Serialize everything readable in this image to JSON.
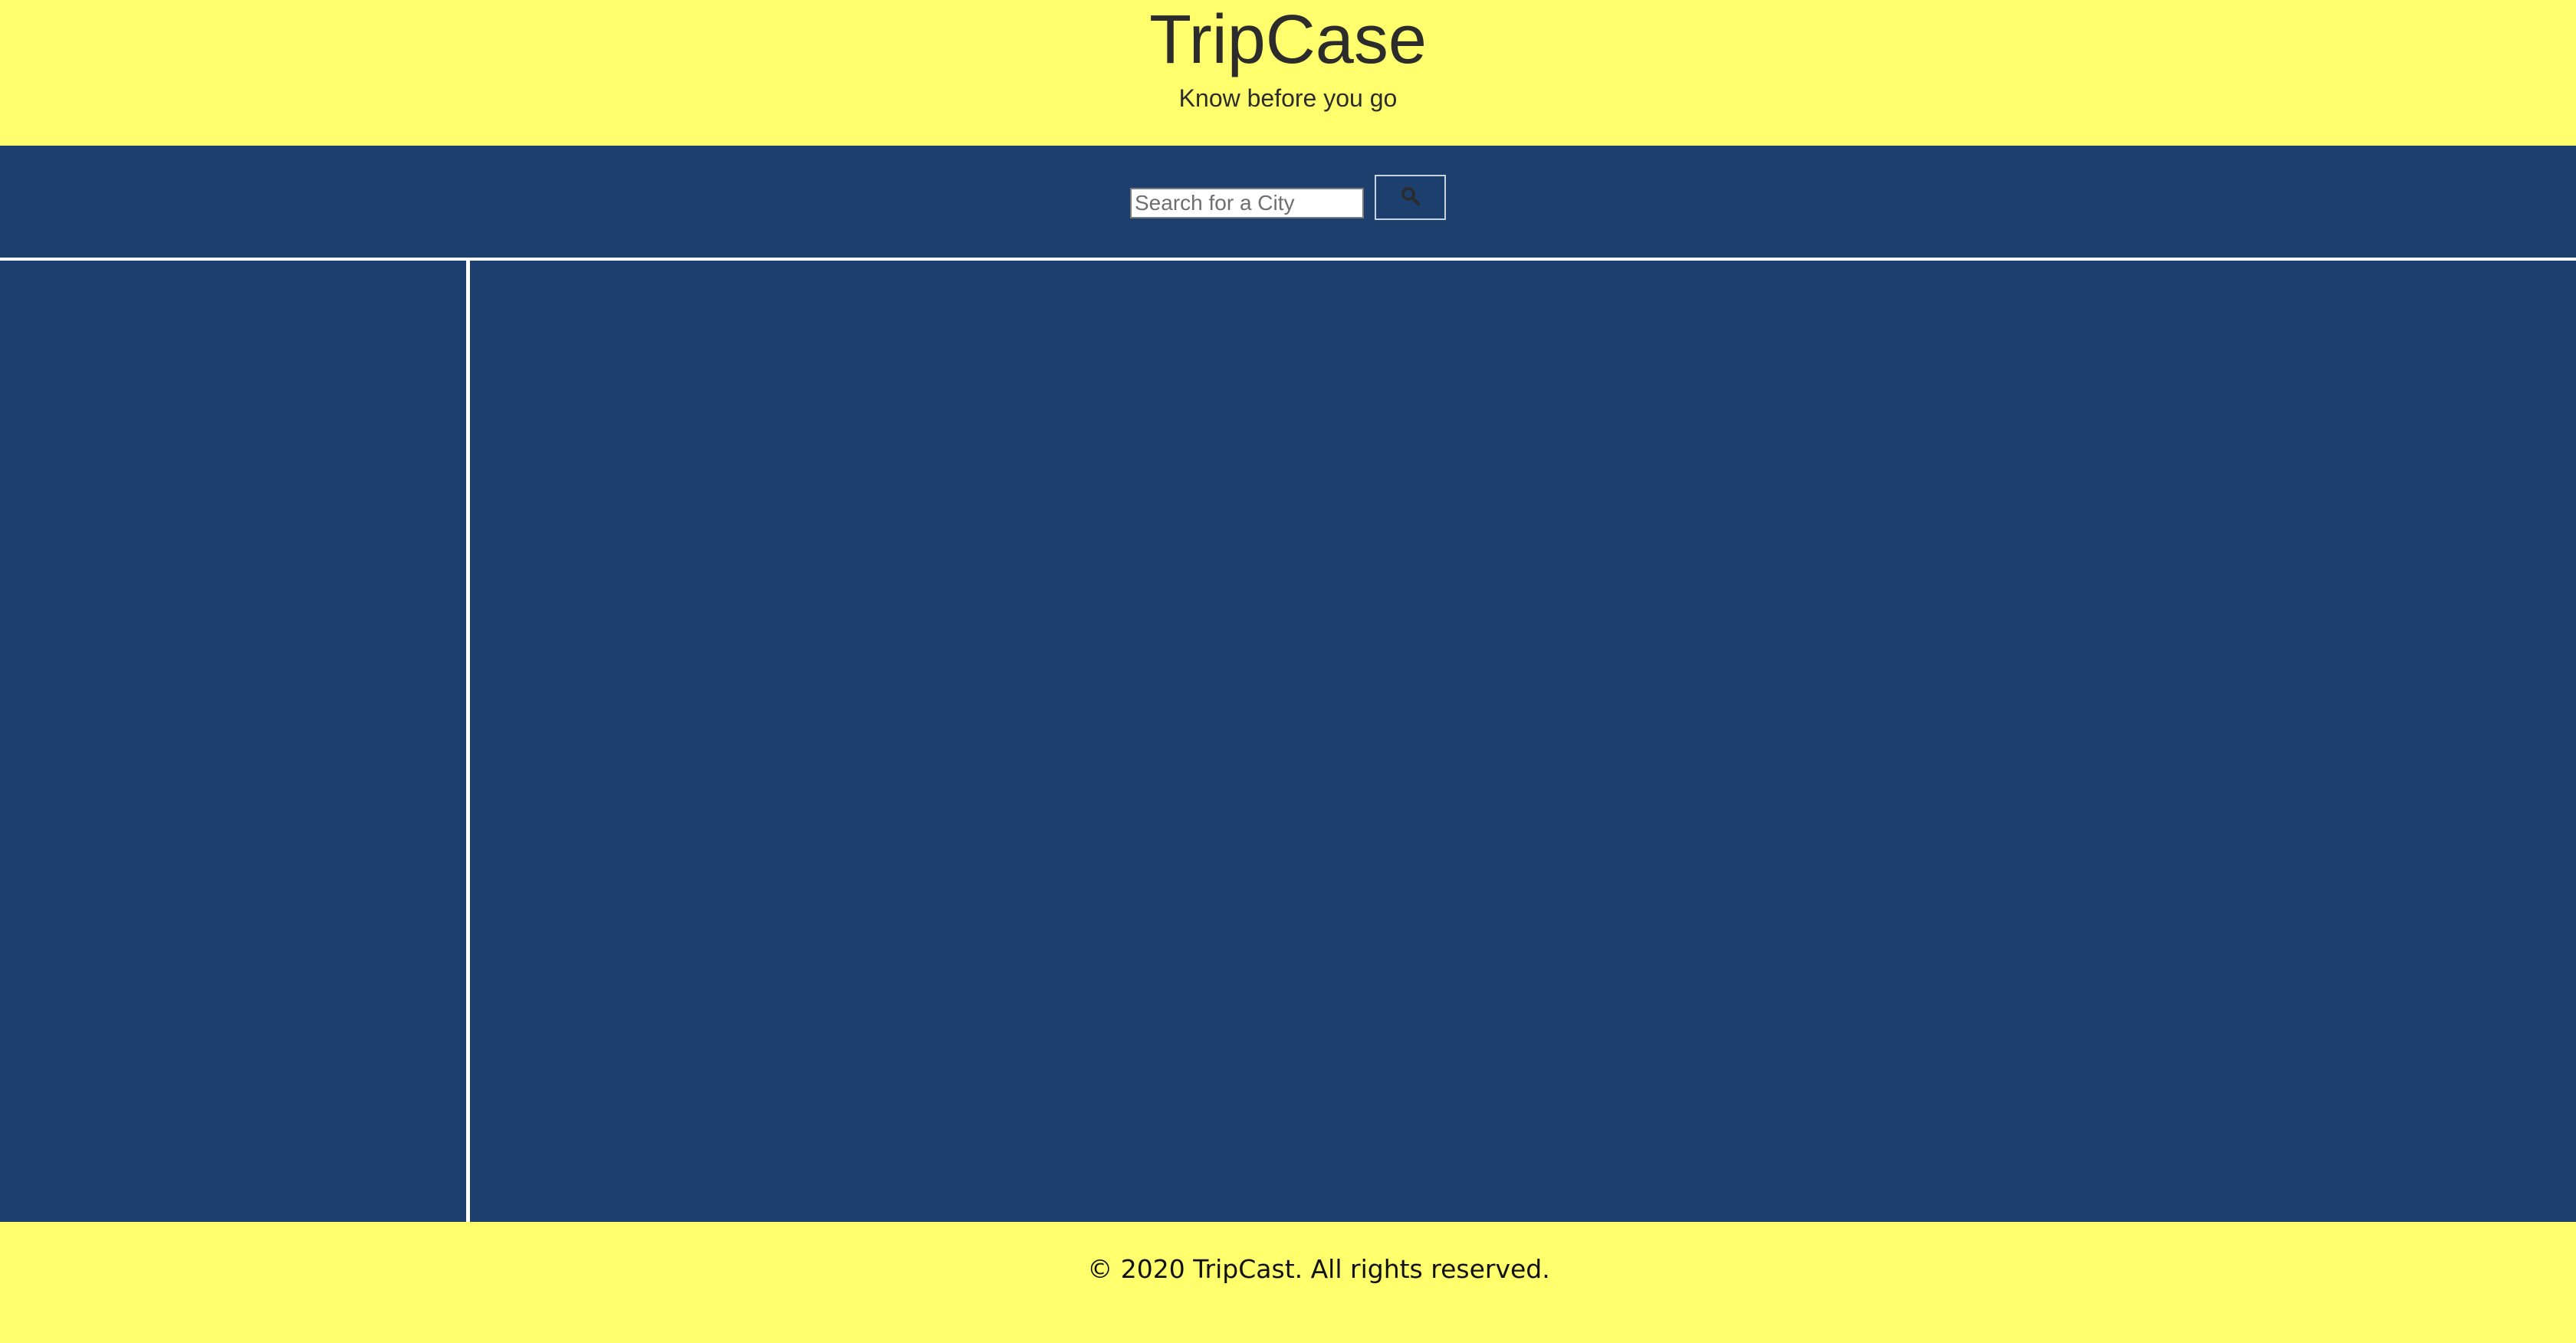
{
  "header": {
    "title": "TripCase",
    "tagline": "Know before you go"
  },
  "search": {
    "placeholder": "Search for a City",
    "value": "",
    "button_icon": "search-icon"
  },
  "footer": {
    "copyright": "© 2020 TripCast. All rights reserved."
  },
  "colors": {
    "header_bg": "#ffff6e",
    "body_bg": "#1c3f6e",
    "divider": "#ffffff"
  }
}
